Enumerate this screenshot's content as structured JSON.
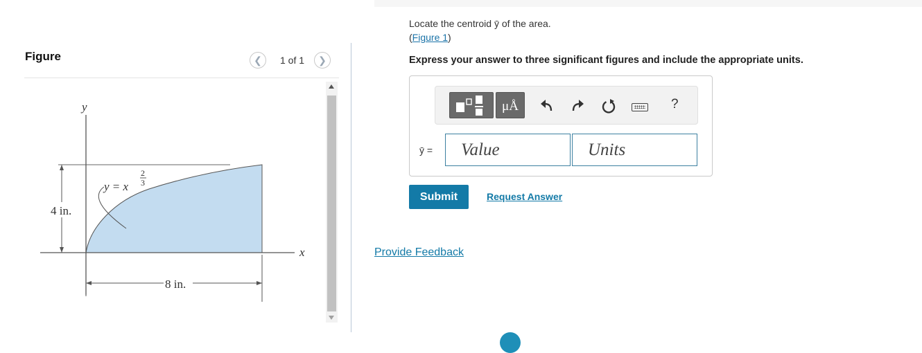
{
  "figure_panel": {
    "title": "Figure",
    "pager_text": "1 of 1",
    "prev_icon": "chevron-left-icon",
    "next_icon": "chevron-right-icon",
    "diagram": {
      "y_axis_label": "y",
      "x_axis_label": "x",
      "curve_label_lhs": "y = x",
      "exponent_num": "2",
      "exponent_den": "3",
      "height_label": "4 in.",
      "width_label": "8 in.",
      "fill_color": "#c3dcf0"
    }
  },
  "problem": {
    "question_text": "Locate the centroid ȳ of the area.",
    "figure_link_open": "(",
    "figure_link_label": "Figure 1",
    "figure_link_close": ")",
    "instruction": "Express your answer to three significant figures and include the appropriate units.",
    "toolbar": {
      "units_btn_label": "μÅ",
      "undo_icon": "undo-icon",
      "redo_icon": "redo-icon",
      "reset_icon": "reset-icon",
      "keyboard_icon": "keyboard-icon",
      "help_label": "?"
    },
    "answer_label": "ȳ =",
    "value_placeholder": "Value",
    "units_placeholder": "Units",
    "submit_label": "Submit",
    "request_answer_label": "Request Answer",
    "feedback_label": "Provide Feedback"
  },
  "colors": {
    "accent": "#137aa7",
    "link": "#1a73a8"
  }
}
